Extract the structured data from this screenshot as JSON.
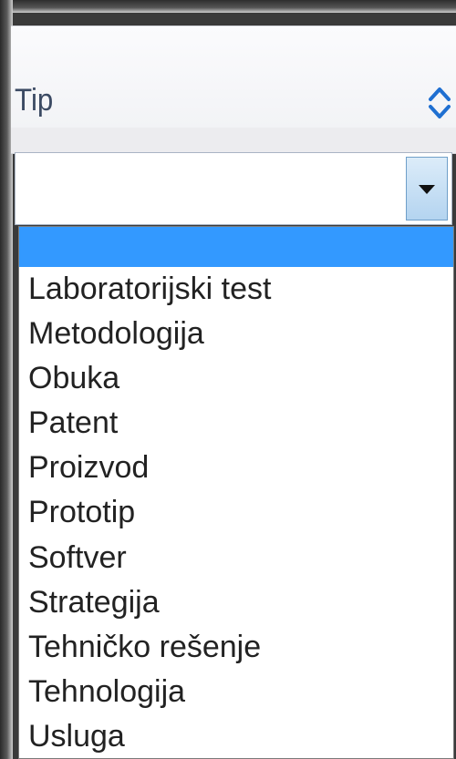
{
  "column": {
    "title": "Tip"
  },
  "filter": {
    "selected_value": ""
  },
  "dropdown": {
    "options": [
      "",
      "Laboratorijski test",
      "Metodologija",
      "Obuka",
      "Patent",
      "Proizvod",
      "Prototip",
      "Softver",
      "Strategija",
      "Tehničko rešenje",
      "Tehnologija",
      "Usluga"
    ],
    "highlighted_index": 0,
    "highlight_color": "#3399ff"
  },
  "colors": {
    "header_text": "#3b4a63",
    "sort_icon": "#1f6fd1",
    "arrow_button": "#b4d4f0"
  },
  "icons": [
    "sort-icon",
    "dropdown-arrow-icon"
  ]
}
